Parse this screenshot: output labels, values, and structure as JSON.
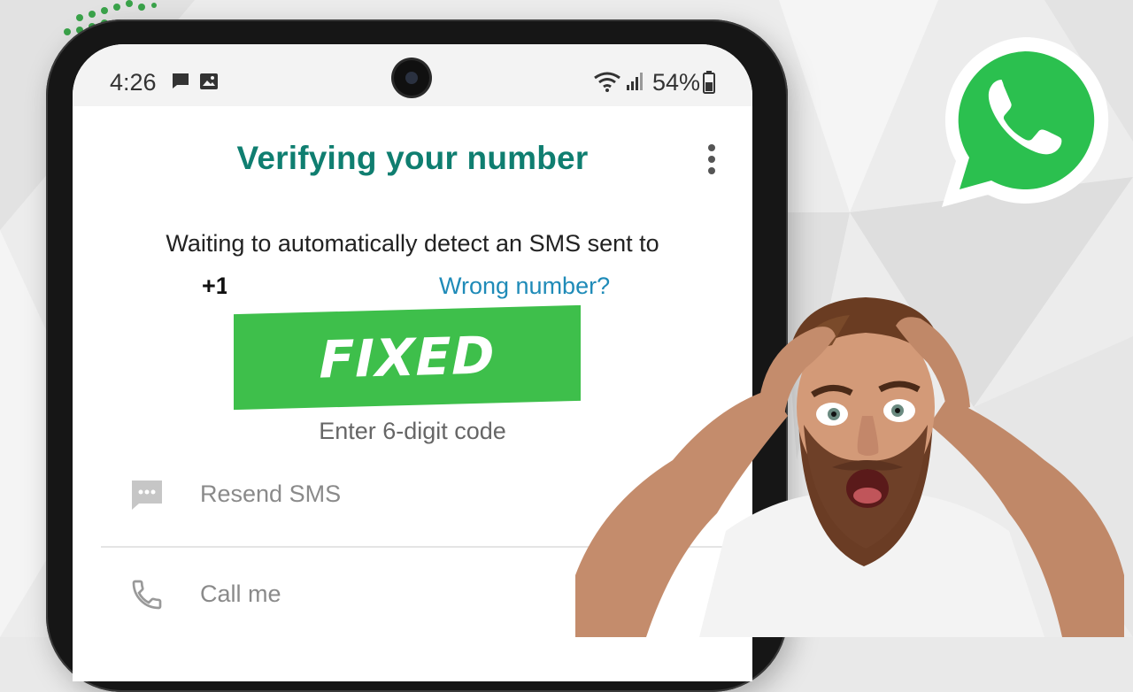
{
  "status_bar": {
    "time": "4:26",
    "battery_percent": "54%",
    "icons": [
      "message-icon",
      "image-icon",
      "wifi-icon",
      "signal-icon",
      "battery-icon"
    ]
  },
  "screen": {
    "title": "Verifying your number",
    "menu_icon": "more-vert-icon",
    "waiting_text": "Waiting to automatically detect an SMS sent to",
    "phone_prefix": "+1",
    "wrong_number_link": "Wrong number?",
    "code_label": "Enter 6-digit code",
    "options": [
      {
        "label": "Resend SMS",
        "icon": "sms-icon"
      },
      {
        "label": "Call me",
        "icon": "phone-icon"
      }
    ]
  },
  "overlay": {
    "banner_text": "FIXED",
    "logo": "whatsapp-logo"
  },
  "colors": {
    "title_green": "#0f7e70",
    "link_blue": "#1f8bb8",
    "banner_green": "#3ebf4b",
    "whatsapp_green": "#25d366"
  }
}
